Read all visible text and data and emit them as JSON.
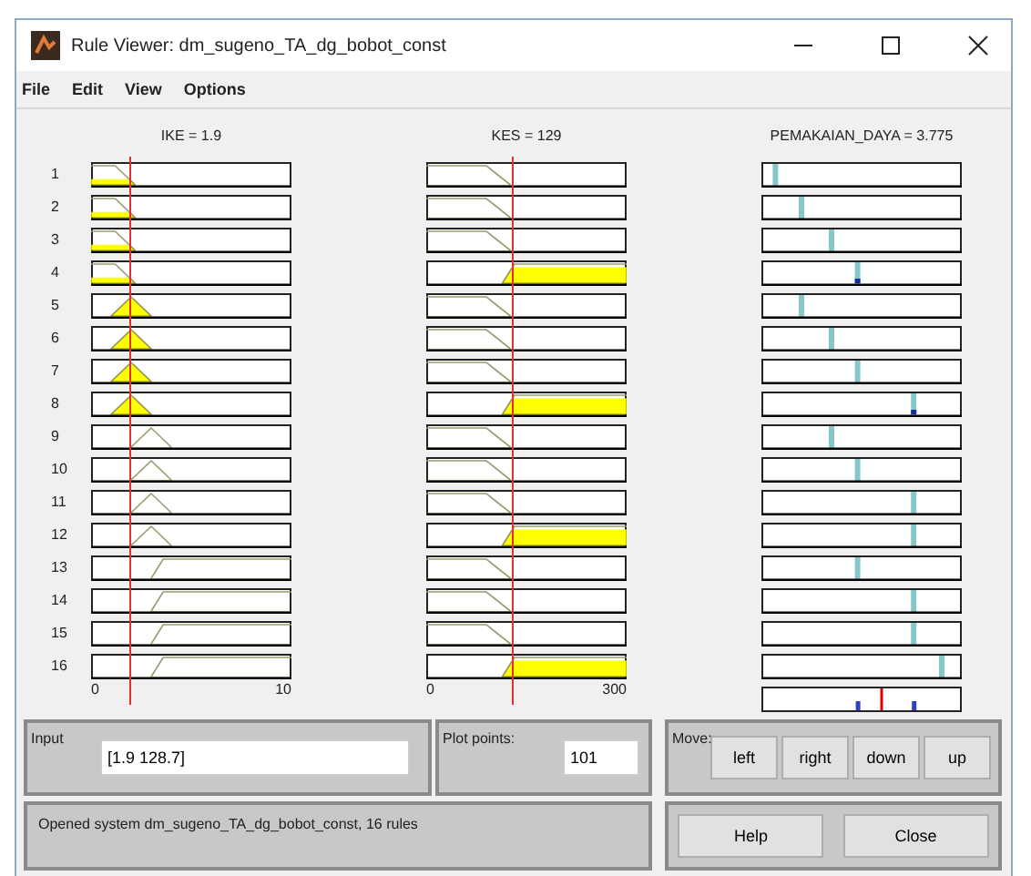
{
  "window": {
    "title": "Rule Viewer: dm_sugeno_TA_dg_bobot_const"
  },
  "menu": [
    "File",
    "Edit",
    "View",
    "Options"
  ],
  "inputs": [
    {
      "title": "IKE = 1.9",
      "min_label": "0",
      "max_label": "10"
    },
    {
      "title": "KES = 129",
      "min_label": "0",
      "max_label": "300"
    }
  ],
  "output": {
    "title": "PEMAKAIAN_DAYA = 3.775"
  },
  "rules": [
    {
      "number": "1"
    },
    {
      "number": "2"
    },
    {
      "number": "3"
    },
    {
      "number": "4"
    },
    {
      "number": "5"
    },
    {
      "number": "6"
    },
    {
      "number": "7"
    },
    {
      "number": "8"
    },
    {
      "number": "9"
    },
    {
      "number": "10"
    },
    {
      "number": "11"
    },
    {
      "number": "12"
    },
    {
      "number": "13"
    },
    {
      "number": "14"
    },
    {
      "number": "15"
    },
    {
      "number": "16"
    }
  ],
  "input_field": {
    "label": "Input",
    "value": "[1.9 128.7]"
  },
  "plot_points": {
    "label": "Plot points:",
    "value": "101"
  },
  "move": {
    "label": "Move:",
    "buttons": [
      "left",
      "right",
      "down",
      "up"
    ]
  },
  "status": "Opened system dm_sugeno_TA_dg_bobot_const, 16 rules",
  "buttons": [
    "Help",
    "Close"
  ]
}
